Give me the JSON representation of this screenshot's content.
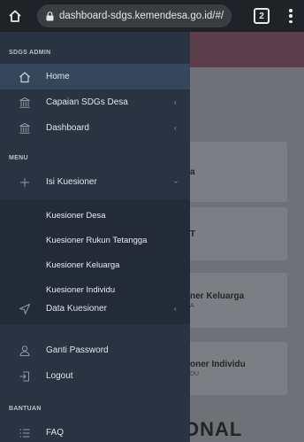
{
  "browser": {
    "url": "dashboard-sdgs.kemendesa.go.id/#/",
    "tab_count": "2"
  },
  "sidebar": {
    "sections": {
      "admin": "SDGS ADMIN",
      "menu": "MENU",
      "bantuan": "BANTUAN"
    },
    "items": {
      "home": "Home",
      "capaian": "Capaian SDGs Desa",
      "dashboard": "Dashboard",
      "isi_kuesioner": "Isi Kuesioner",
      "data_kuesioner": "Data Kuesioner",
      "ganti_password": "Ganti Password",
      "logout": "Logout",
      "faq": "FAQ"
    },
    "submenu": [
      "Kuesioner Desa",
      "Kuesioner Rukun Tetangga",
      "Kuesioner Keluarga",
      "Kuesioner Individu"
    ]
  },
  "background": {
    "card1": "a",
    "card2": "T",
    "card3_title": "ner Keluarga",
    "card3_sub": "A",
    "card4_title": "oner Individu",
    "card4_sub": "DU",
    "big_text": "ONAL"
  },
  "colors": {
    "drawer_bg": "#2a3341",
    "active_item": "#37475b",
    "submenu_bg": "#222b37"
  },
  "icons": {
    "home": "home-icon",
    "capaian": "bank-icon",
    "dashboard": "bank-icon",
    "isi_kuesioner": "plus-icon",
    "data_kuesioner": "send-icon",
    "ganti_password": "user-icon",
    "logout": "logout-icon",
    "faq": "list-icon"
  }
}
